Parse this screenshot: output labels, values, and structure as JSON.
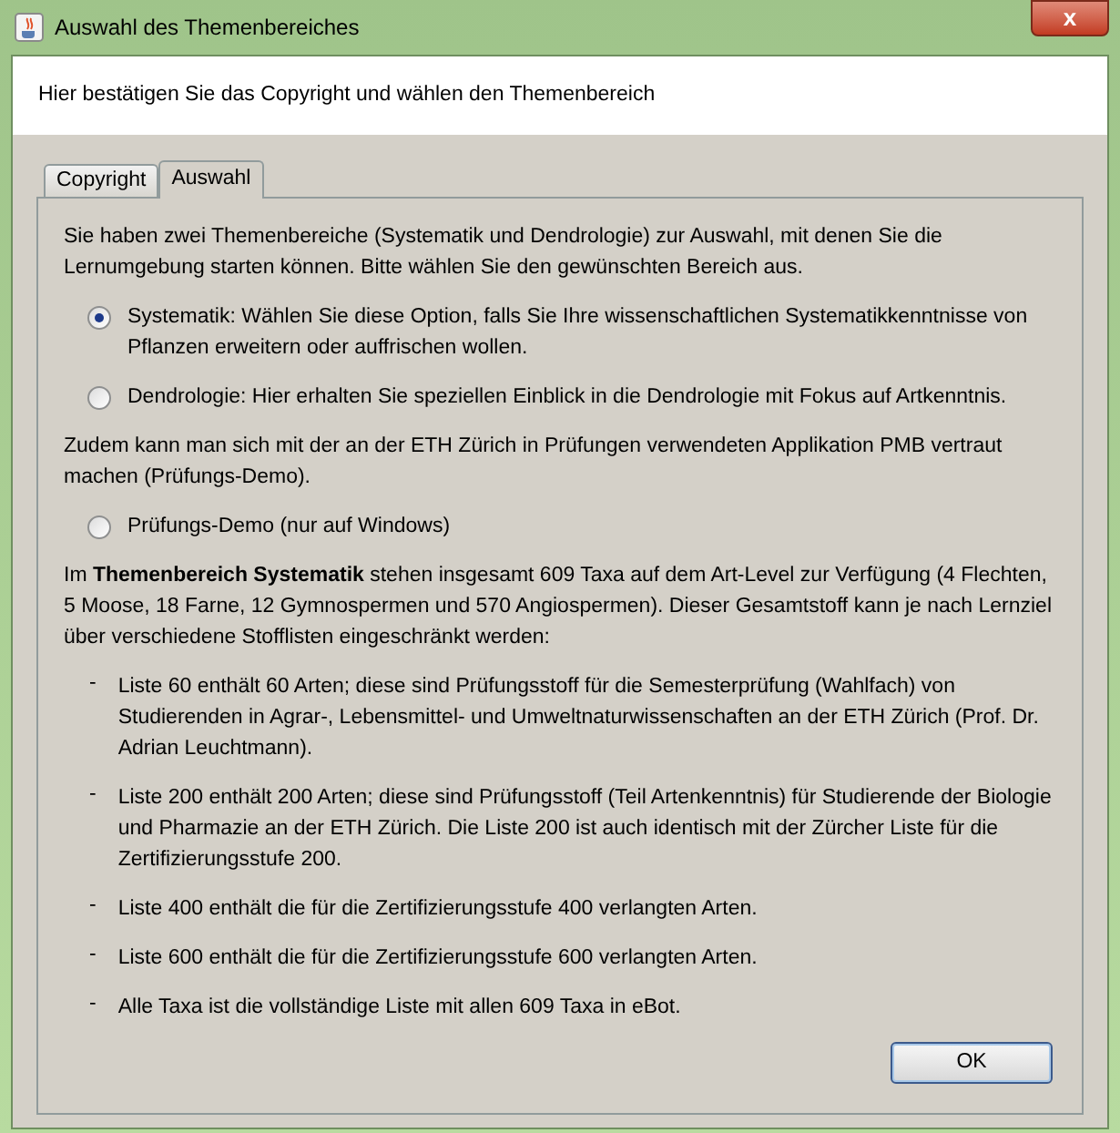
{
  "window": {
    "title": "Auswahl des Themenbereiches",
    "close": "x"
  },
  "header": {
    "text": "Hier bestätigen Sie das Copyright und wählen den Themenbereich"
  },
  "tabs": [
    {
      "label": "Copyright",
      "selected": false
    },
    {
      "label": "Auswahl",
      "selected": true
    }
  ],
  "intro": "Sie haben zwei Themenbereiche (Systematik und Dendrologie) zur Auswahl, mit denen Sie die Lernumgebung starten können. Bitte wählen Sie den gewünschten Bereich aus.",
  "options": [
    {
      "label": "Systematik: Wählen Sie diese Option, falls Sie Ihre wissenschaftlichen Systematikkenntnisse von Pflanzen erweitern oder auffrischen wollen.",
      "selected": true
    },
    {
      "label": "Dendrologie: Hier erhalten Sie speziellen Einblick in die Dendrologie mit Fokus auf Artkenntnis.",
      "selected": false
    }
  ],
  "demo_text": "Zudem kann man sich mit der an der ETH Zürich in Prüfungen verwendeten Applikation PMB vertraut machen (Prüfungs-Demo).",
  "demo_options": [
    {
      "label": "Prüfungs-Demo (nur auf Windows)",
      "selected": false
    }
  ],
  "description": "Im **Themenbereich Systematik** stehen insgesamt 609 Taxa auf dem Art-Level zur Verfügung (4 Flechten, 5 Moose, 18 Farne, 12 Gymnospermen und 570 Angiospermen). Dieser Gesamtstoff kann je nach Lernziel über verschiedene Stofflisten eingeschränkt werden:",
  "lists": [
    {
      "marker": "-",
      "text": "Liste 60 enthält 60 Arten; diese sind Prüfungsstoff für die Semesterprüfung (Wahlfach) von Studierenden in Agrar-, Lebensmittel- und Umweltnaturwissenschaften an der ETH Zürich (Prof. Dr. Adrian Leuchtmann)."
    },
    {
      "marker": "-",
      "text": "Liste 200 enthält 200 Arten; diese sind Prüfungsstoff (Teil Artenkenntnis) für Studierende der Biologie und Pharmazie an der ETH Zürich. Die Liste 200 ist auch identisch mit der Zürcher Liste für die Zertifizierungsstufe 200."
    },
    {
      "marker": "-",
      "text": "Liste 400 enthält die für die Zertifizierungsstufe 400 verlangten Arten."
    },
    {
      "marker": "-",
      "text": "Liste 600 enthält die für die Zertifizierungsstufe 600 verlangten Arten."
    },
    {
      "marker": "-",
      "text": "Alle Taxa ist die vollständige Liste mit allen 609 Taxa in eBot."
    }
  ],
  "buttons": [
    "OK"
  ]
}
